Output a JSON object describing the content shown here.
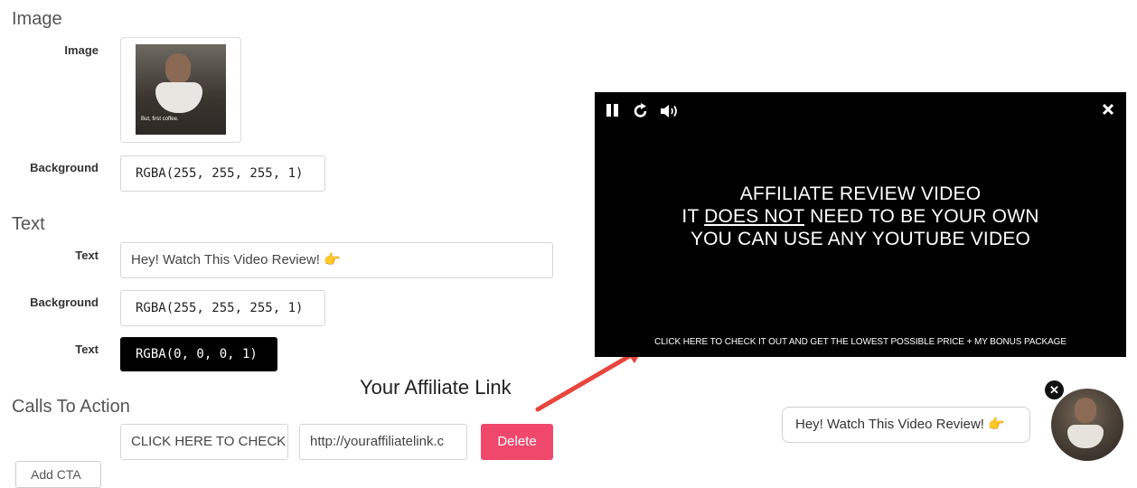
{
  "sections": {
    "image": "Image",
    "text": "Text",
    "cta": "Calls To Action"
  },
  "image_section": {
    "image_label": "Image",
    "background_label": "Background",
    "background_value": "RGBA(255, 255, 255, 1)",
    "thumb_caption": "But, first coffee."
  },
  "text_section": {
    "text_label": "Text",
    "text_value": "Hey! Watch This Video Review! 👉",
    "background_label": "Background",
    "background_value": "RGBA(255, 255, 255, 1)",
    "color_label": "Text",
    "color_value": "RGBA(0, 0, 0, 1)"
  },
  "cta_section": {
    "cta_text": "CLICK HERE TO CHECK",
    "cta_url": "http://youraffiliatelink.c",
    "delete_label": "Delete",
    "add_label": "Add CTA"
  },
  "annotation": {
    "text": "Your Affiliate Link",
    "arrow_color": "#e8453c"
  },
  "video": {
    "icons": [
      "pause-icon",
      "replay-icon",
      "volume-icon",
      "close-icon"
    ],
    "line1": "AFFILIATE REVIEW VIDEO",
    "line2_prefix": "IT ",
    "line2_underlined": "DOES NOT",
    "line2_suffix": " NEED TO BE YOUR OWN",
    "line3": "YOU CAN USE ANY YOUTUBE VIDEO",
    "cta": "CLICK HERE TO CHECK IT OUT AND GET THE LOWEST POSSIBLE PRICE + MY BONUS PACKAGE"
  },
  "widget": {
    "bubble_text": "Hey! Watch This Video Review! 👉",
    "close_glyph": "✕"
  },
  "colors": {
    "delete_button": "#f0486d",
    "video_bg": "#000000"
  }
}
